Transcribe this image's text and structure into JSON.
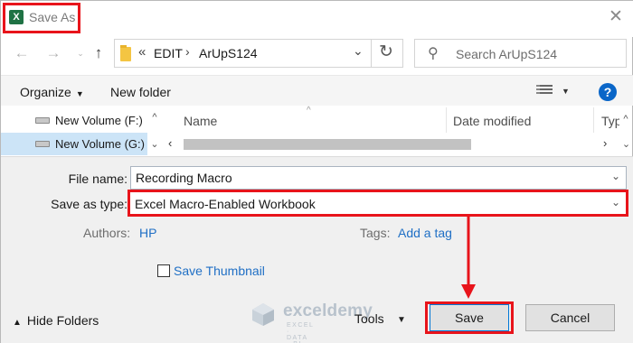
{
  "window": {
    "title": "Save As",
    "app_icon": "excel-icon"
  },
  "address": {
    "overflow": "«",
    "crumbs": [
      "EDIT",
      "ArUpS124"
    ],
    "search_placeholder": "Search ArUpS124"
  },
  "toolbar": {
    "organize_label": "Organize",
    "new_folder_label": "New folder",
    "help_glyph": "?"
  },
  "nav_pane": {
    "items": [
      {
        "label": "New Volume (F:)",
        "selected": false
      },
      {
        "label": "New Volume (G:)",
        "selected": true
      }
    ]
  },
  "file_list": {
    "columns": [
      "Name",
      "Date modified",
      "Typ"
    ],
    "sorted_column": "Name"
  },
  "form": {
    "file_name_label": "File name:",
    "file_name_value": "Recording Macro",
    "save_type_label": "Save as type:",
    "save_type_value": "Excel Macro-Enabled Workbook",
    "authors_label": "Authors:",
    "authors_value": "HP",
    "tags_label": "Tags:",
    "tags_value": "Add a tag",
    "save_thumbnail_label": "Save Thumbnail",
    "save_thumbnail_checked": false
  },
  "footer": {
    "hide_folders_label": "Hide Folders",
    "tools_label": "Tools",
    "save_label": "Save",
    "cancel_label": "Cancel"
  },
  "watermark": {
    "name": "exceldemy",
    "tagline": "EXCEL · DATA · BI"
  },
  "annotations": {
    "highlight_color": "#e8141b"
  }
}
